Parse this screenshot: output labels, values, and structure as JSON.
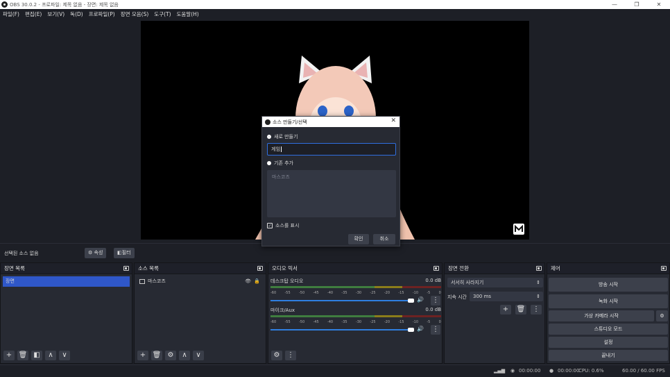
{
  "window": {
    "title": "OBS 30.0.2 - 프로파일: 제목 없음 - 장면: 제목 없음",
    "controls": [
      "—",
      "❐",
      "✕"
    ]
  },
  "menu": [
    "파일(F)",
    "편집(E)",
    "보기(V)",
    "독(D)",
    "프로파일(P)",
    "장면 모음(S)",
    "도구(T)",
    "도움말(H)"
  ],
  "source_bar": {
    "no_source": "선택된 소스 없음",
    "properties": "속성",
    "filters": "필터"
  },
  "docks": {
    "scenes": {
      "title": "장면 목록",
      "items": [
        "장면"
      ]
    },
    "sources": {
      "title": "소스 목록",
      "items": [
        "마스코즈"
      ]
    },
    "mixer": {
      "title": "오디오 믹서",
      "channels": [
        {
          "name": "데스크탑 오디오",
          "db": "0.0 dB"
        },
        {
          "name": "마이크/Aux",
          "db": "0.0 dB"
        }
      ],
      "scale": [
        "-60",
        "-55",
        "-50",
        "-45",
        "-40",
        "-35",
        "-30",
        "-25",
        "-20",
        "-15",
        "-10",
        "-5",
        "0"
      ]
    },
    "transitions": {
      "title": "장면 전환",
      "type": "서서히 사라지기",
      "duration_label": "지속 시간",
      "duration": "300 ms"
    },
    "controls": {
      "title": "제어",
      "buttons": [
        "방송 시작",
        "녹화 시작",
        "가상 카메라 시작",
        "스튜디오 모드",
        "설정",
        "끝내기"
      ]
    }
  },
  "dialog": {
    "title": "소스 만들기/선택",
    "create_new": "새로 만들기",
    "name_value": "게임",
    "add_existing": "기존 추가",
    "existing_items": [
      "마스코즈"
    ],
    "make_visible": "소스를 표시",
    "ok": "확인",
    "cancel": "취소"
  },
  "status": {
    "rec_time": "00:00:00",
    "stream_time": "00:00:00",
    "cpu": "CPU: 0.6%",
    "fps": "60.00 / 60.00 FPS"
  },
  "colors": {
    "accent": "#2f57c9",
    "meter_green": "#4caf50",
    "meter_yellow": "#c8b400",
    "meter_red": "#b02020",
    "volume_blue": "#2f7fe0"
  }
}
